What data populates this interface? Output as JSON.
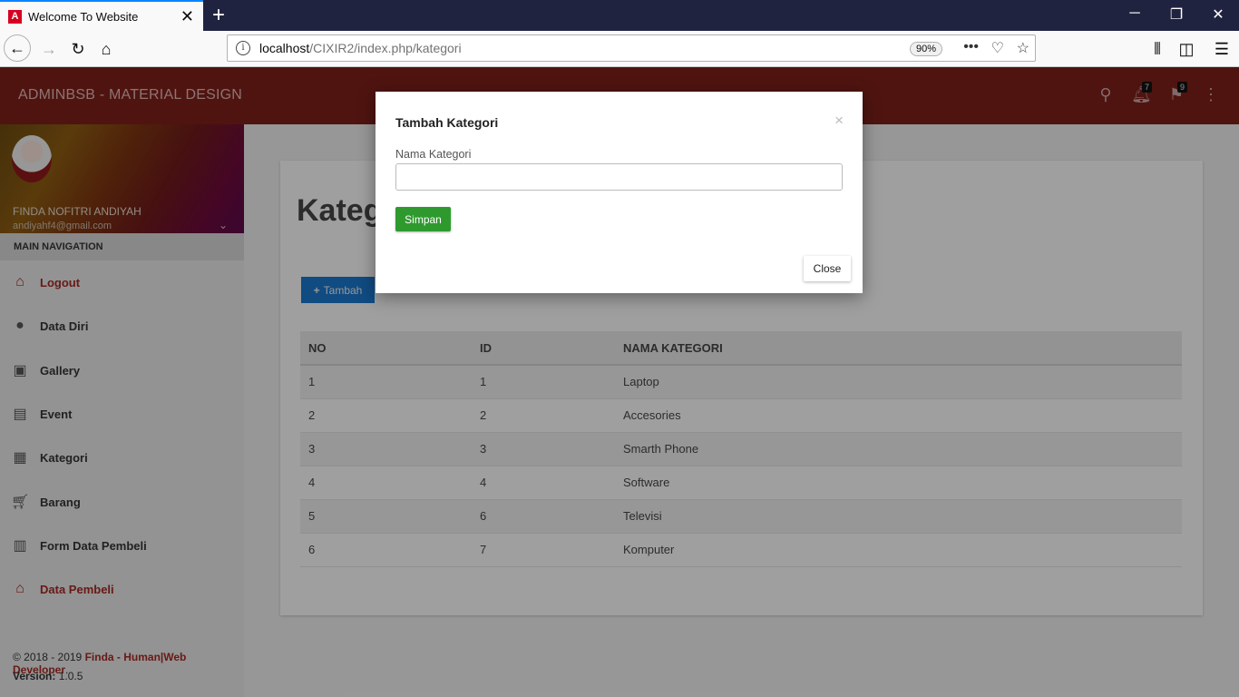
{
  "browser": {
    "tab_title": "Welcome To Website",
    "url_host": "localhost",
    "url_path": "/CIXIR2/index.php/kategori",
    "zoom": "90%"
  },
  "app": {
    "brand": "ADMINBSB - MATERIAL DESIGN",
    "notifications_count": "7",
    "flags_count": "9"
  },
  "user": {
    "name": "FINDA NOFITRI ANDIYAH",
    "email": "andiyahf4@gmail.com"
  },
  "sidebar": {
    "header": "MAIN NAVIGATION",
    "items": [
      {
        "label": "Logout",
        "icon": "home-icon",
        "active": true
      },
      {
        "label": "Data Diri",
        "icon": "person-icon",
        "active": false
      },
      {
        "label": "Gallery",
        "icon": "image-icon",
        "active": false
      },
      {
        "label": "Event",
        "icon": "calendar-icon",
        "active": false
      },
      {
        "label": "Kategori",
        "icon": "dashboard-icon",
        "active": false
      },
      {
        "label": "Barang",
        "icon": "cart-icon",
        "active": false
      },
      {
        "label": "Form Data Pembeli",
        "icon": "clipboard-icon",
        "active": false
      },
      {
        "label": "Data Pembeli",
        "icon": "home-icon",
        "active": true
      }
    ],
    "footer": {
      "copy_prefix": "© 2018 - 2019 ",
      "copy_link": "Finda - Human|Web Developer",
      "copy_suffix": ".",
      "version_label": "Version:",
      "version_value": " 1.0.5"
    }
  },
  "main": {
    "title": "Kategori",
    "add_button": "Tambah",
    "table": {
      "headers": [
        "NO",
        "ID",
        "NAMA KATEGORI"
      ],
      "rows": [
        [
          "1",
          "1",
          "Laptop"
        ],
        [
          "2",
          "2",
          "Accesories"
        ],
        [
          "3",
          "3",
          "Smarth Phone"
        ],
        [
          "4",
          "4",
          "Software"
        ],
        [
          "5",
          "6",
          "Televisi"
        ],
        [
          "6",
          "7",
          "Komputer"
        ]
      ]
    }
  },
  "modal": {
    "title": "Tambah Kategori",
    "field_label": "Nama Kategori",
    "field_value": "",
    "submit": "Simpan",
    "close": "Close",
    "close_x": "×"
  },
  "colors": {
    "header": "#7a1f1a",
    "accent": "#a02822",
    "primary_button": "#1a73c8",
    "success_button": "#2e9a2e"
  }
}
